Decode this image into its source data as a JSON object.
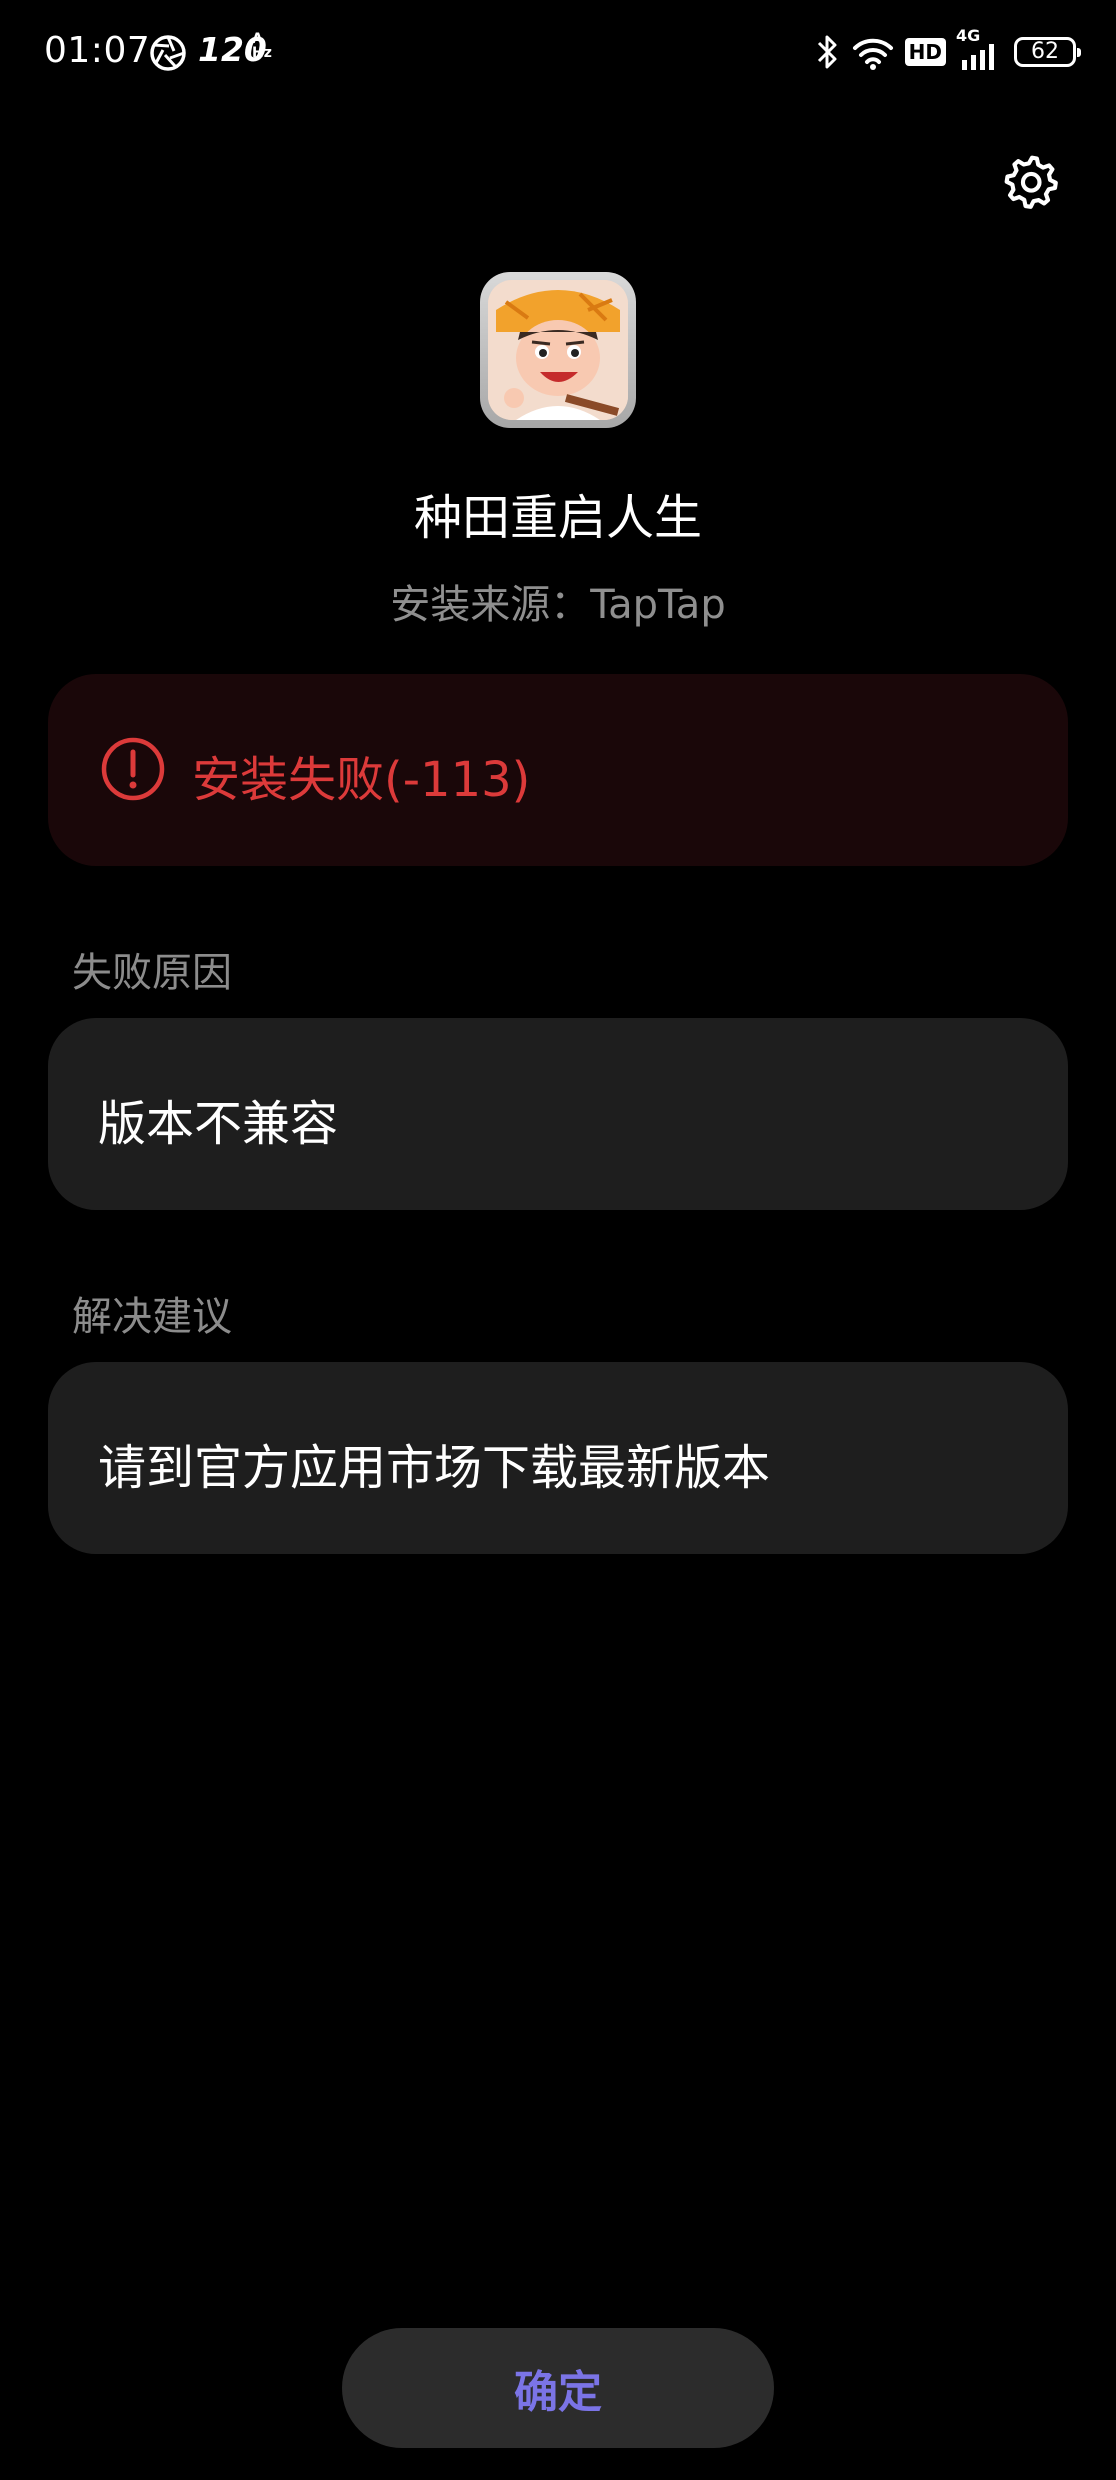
{
  "status_bar": {
    "time": "01:07",
    "refresh_rate": "120",
    "refresh_rate_unit": "Hz",
    "refresh_rate_badge": "A",
    "hd_label": "HD",
    "network_label": "4G",
    "battery": "62"
  },
  "app": {
    "name": "种田重启人生",
    "install_source": "安装来源：TapTap"
  },
  "error": {
    "message": "安装失败(-113)",
    "color": "#dc3a3a"
  },
  "failure_reason": {
    "label": "失败原因",
    "value": "版本不兼容"
  },
  "suggestion": {
    "label": "解决建议",
    "value": "请到官方应用市场下载最新版本"
  },
  "actions": {
    "confirm_label": "确定",
    "confirm_color": "#7b74e6"
  },
  "icons": {
    "settings": "gear-icon",
    "error": "exclamation-circle-icon",
    "bluetooth": "bluetooth-icon",
    "wifi": "wifi-icon",
    "signal": "signal-icon",
    "battery": "battery-icon"
  }
}
